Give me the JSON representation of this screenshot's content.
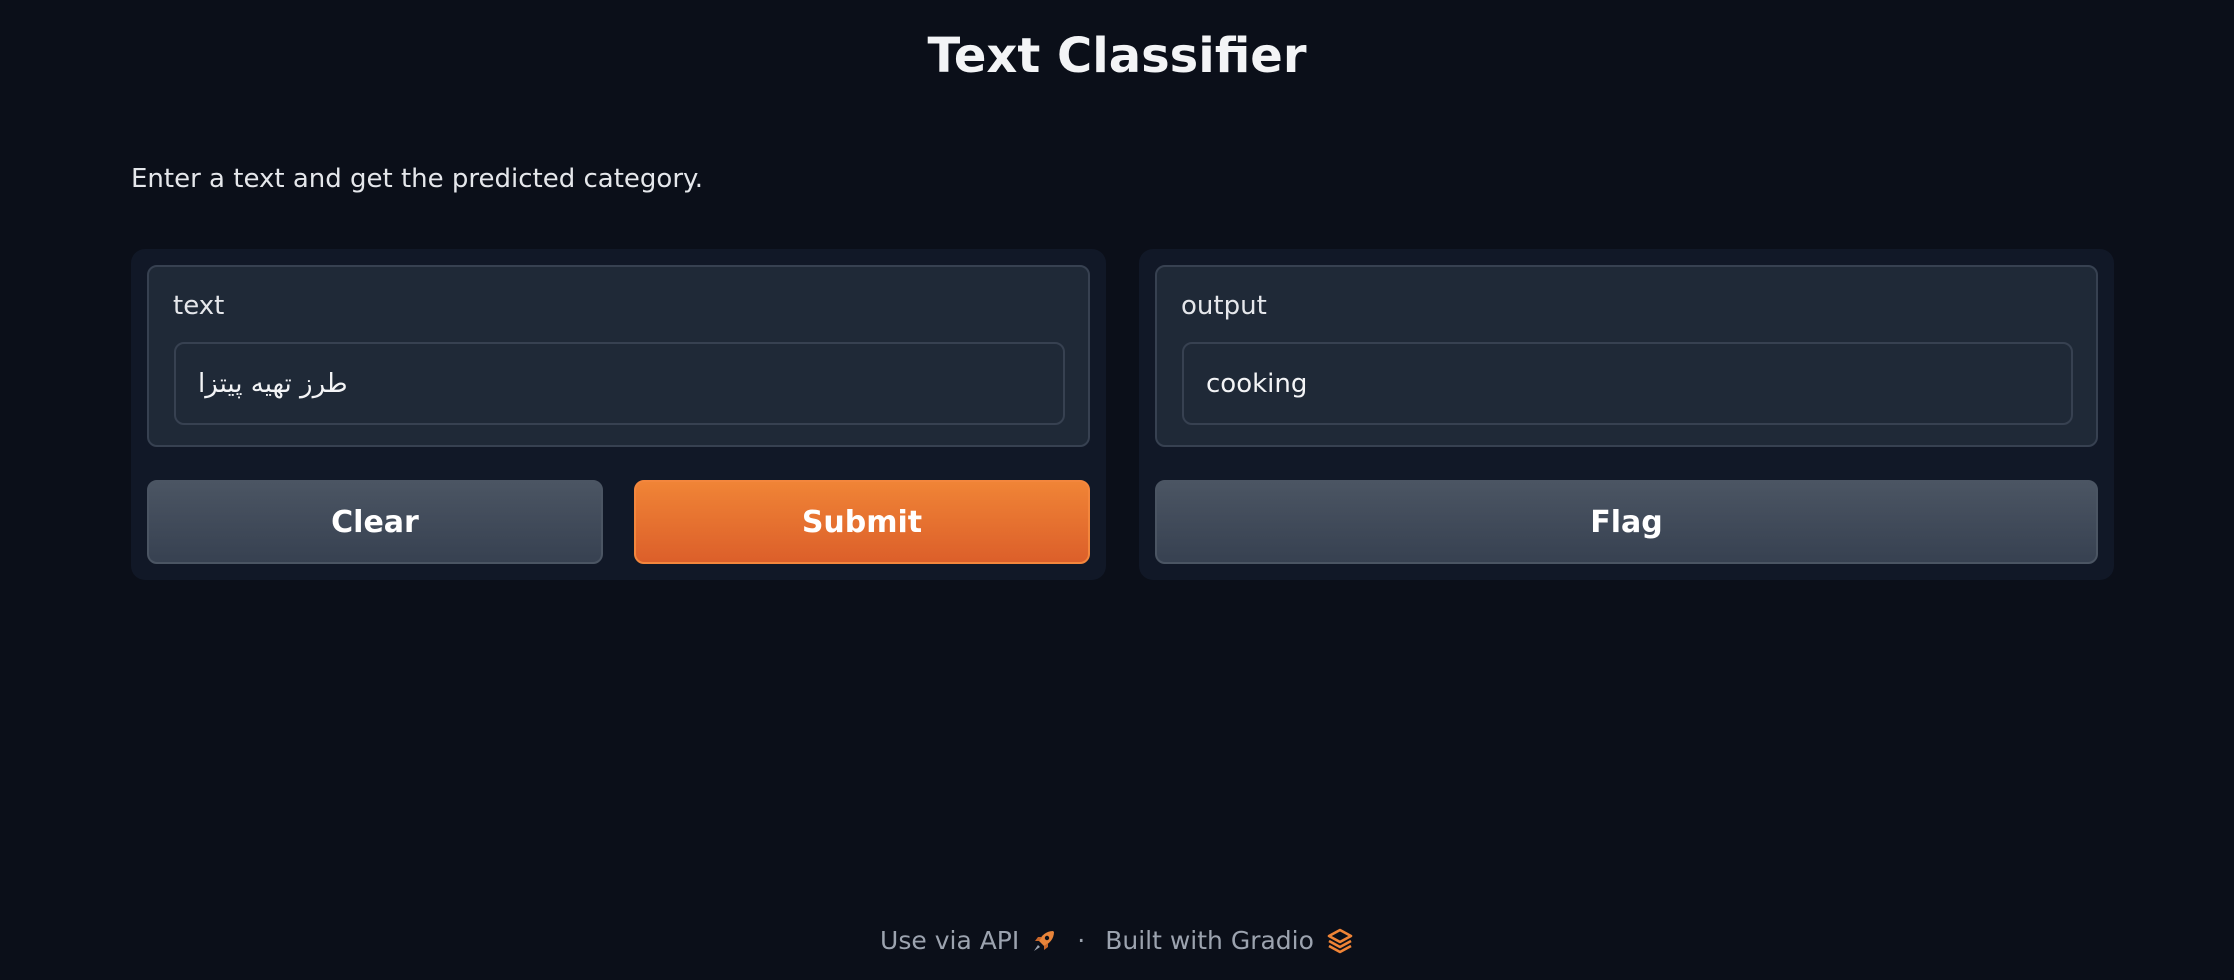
{
  "header": {
    "title": "Text Classifier",
    "description": "Enter a text and get the predicted category."
  },
  "input_panel": {
    "label": "text",
    "value": "طرز تهیه پیتزا",
    "clear_label": "Clear",
    "submit_label": "Submit"
  },
  "output_panel": {
    "label": "output",
    "value": "cooking",
    "flag_label": "Flag"
  },
  "footer": {
    "api_label": "Use via API",
    "api_icon": "rocket-icon",
    "separator": "·",
    "built_with_label": "Built with Gradio",
    "gradio_icon": "gradio-logo-icon"
  },
  "colors": {
    "background": "#0b0f19",
    "panel": "#111827",
    "block": "#1f2937",
    "border": "#374151",
    "primary_accent": "#ea7532",
    "secondary_button": "#4b5563"
  }
}
